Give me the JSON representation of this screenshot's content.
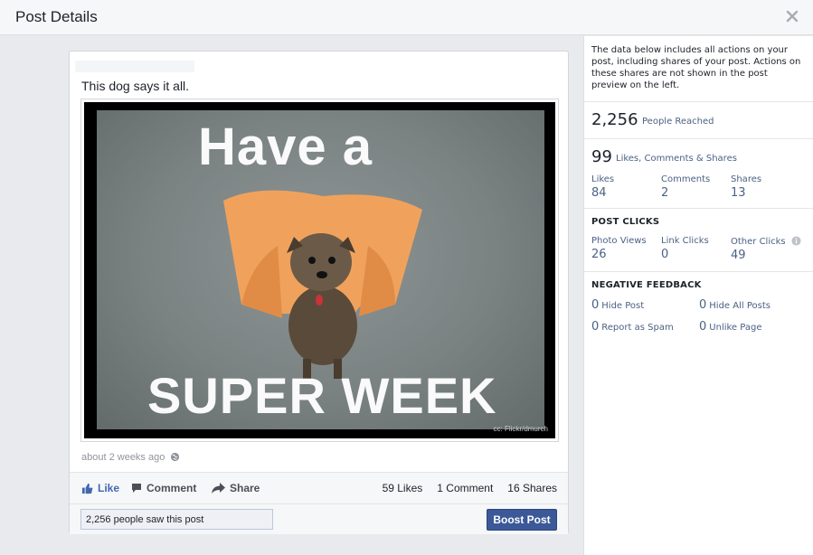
{
  "header": {
    "title": "Post Details"
  },
  "post": {
    "message": "This dog says it all.",
    "image_text": {
      "line1": "Have a",
      "line2": "SUPER WEEK",
      "credit": "cc: Flickr/dmurch"
    },
    "timestamp": "about 2 weeks ago",
    "actions": {
      "like": "Like",
      "comment": "Comment",
      "share": "Share"
    },
    "counts": {
      "likes": "59 Likes",
      "comments": "1 Comment",
      "shares": "16 Shares"
    },
    "saw": "2,256 people saw this post",
    "boost_label": "Boost Post"
  },
  "insights": {
    "intro": "The data below includes all actions on your post, including shares of your post. Actions on these shares are not shown in the post preview on the left.",
    "reached": {
      "value": "2,256",
      "label": "People Reached"
    },
    "engagement": {
      "value": "99",
      "label": "Likes, Comments & Shares",
      "likes": {
        "label": "Likes",
        "value": "84"
      },
      "comments": {
        "label": "Comments",
        "value": "2"
      },
      "shares": {
        "label": "Shares",
        "value": "13"
      }
    },
    "post_clicks": {
      "title": "POST CLICKS",
      "photo_views": {
        "label": "Photo Views",
        "value": "26"
      },
      "link_clicks": {
        "label": "Link Clicks",
        "value": "0"
      },
      "other_clicks": {
        "label": "Other Clicks",
        "value": "49"
      }
    },
    "negative": {
      "title": "NEGATIVE FEEDBACK",
      "hide_post": {
        "value": "0",
        "label": "Hide Post"
      },
      "hide_all": {
        "value": "0",
        "label": "Hide All Posts"
      },
      "report_spam": {
        "value": "0",
        "label": "Report as Spam"
      },
      "unlike_page": {
        "value": "0",
        "label": "Unlike Page"
      }
    }
  },
  "colors": {
    "brand": "#3b5998",
    "like_blue": "#4267b2",
    "label_blue": "#4b6185"
  }
}
